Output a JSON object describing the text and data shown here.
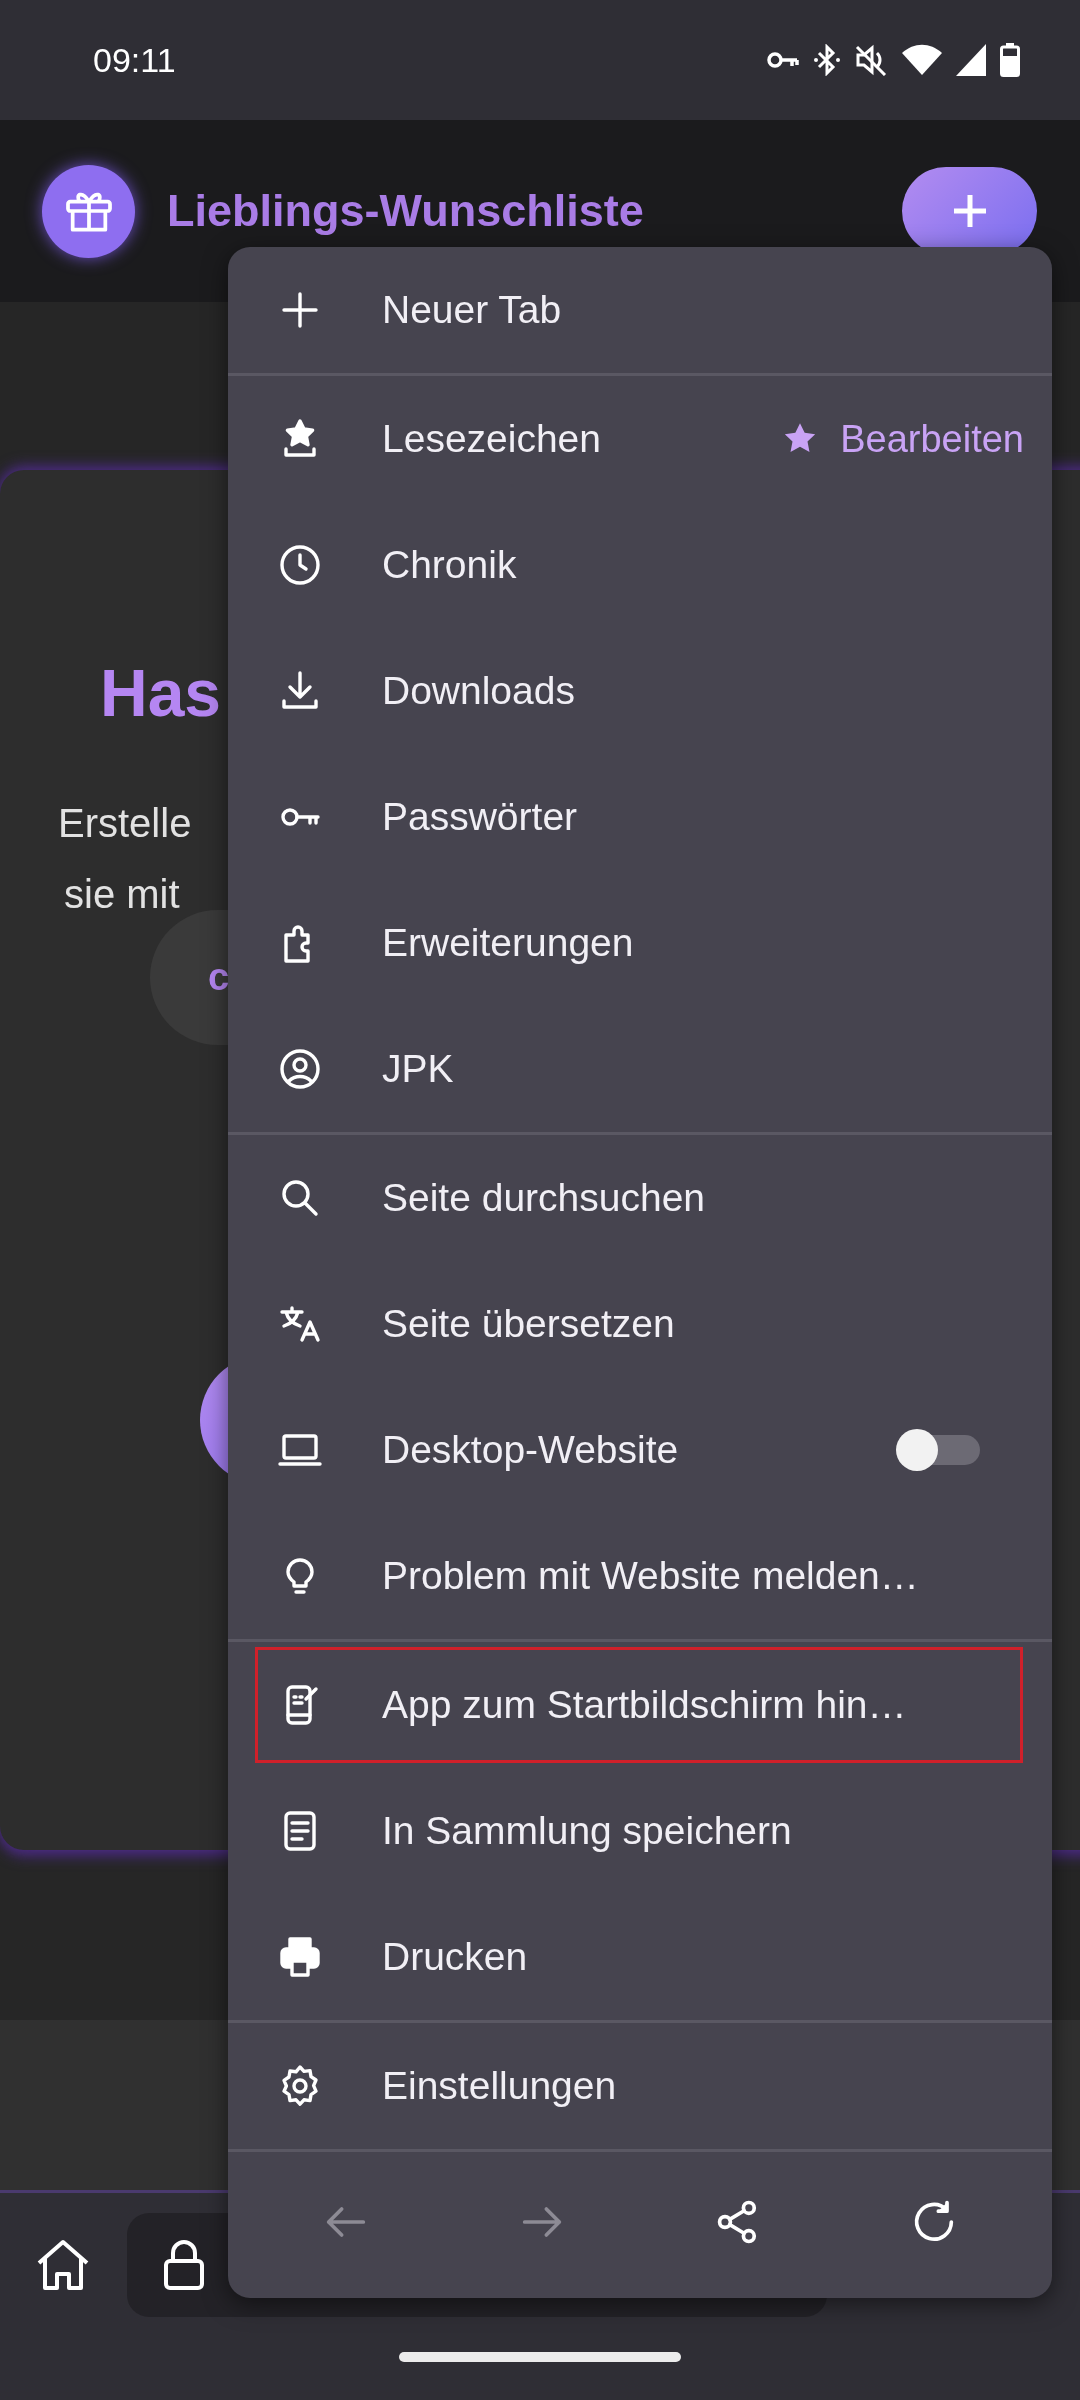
{
  "status_bar": {
    "time": "09:11"
  },
  "header": {
    "title": "Lieblings-Wunschliste"
  },
  "page": {
    "heading": "Has",
    "lines": [
      "Erstelle",
      "sie mit"
    ],
    "button": "c"
  },
  "menu": {
    "sections": [
      [
        {
          "kind": "plain",
          "label": "Neuer Tab",
          "highlighted": false
        }
      ],
      [
        {
          "kind": "action",
          "label": "Lesezeichen",
          "action": "Bearbeiten",
          "highlighted": false
        },
        {
          "kind": "plain",
          "label": "Chronik",
          "highlighted": false
        },
        {
          "kind": "plain",
          "label": "Downloads",
          "highlighted": false
        },
        {
          "kind": "plain",
          "label": "Passwörter",
          "highlighted": false
        },
        {
          "kind": "plain",
          "label": "Erweiterungen",
          "highlighted": false
        },
        {
          "kind": "plain",
          "label": "JPK",
          "highlighted": false
        }
      ],
      [
        {
          "kind": "plain",
          "label": "Seite durchsuchen",
          "highlighted": false
        },
        {
          "kind": "plain",
          "label": "Seite übersetzen",
          "highlighted": false
        },
        {
          "kind": "toggle",
          "label": "Desktop-Website",
          "on": false,
          "highlighted": false
        },
        {
          "kind": "plain",
          "label": "Problem mit Website melden…",
          "highlighted": false
        }
      ],
      [
        {
          "kind": "plain",
          "label": "App zum Startbildschirm hin…",
          "highlighted": true
        },
        {
          "kind": "plain",
          "label": "In Sammlung speichern",
          "highlighted": false
        },
        {
          "kind": "plain",
          "label": "Drucken",
          "highlighted": false
        }
      ],
      [
        {
          "kind": "plain",
          "label": "Einstellungen",
          "highlighted": false
        }
      ]
    ],
    "nav": [
      {
        "disabled": true
      },
      {
        "disabled": true
      },
      {
        "disabled": false
      },
      {
        "disabled": false
      }
    ]
  }
}
